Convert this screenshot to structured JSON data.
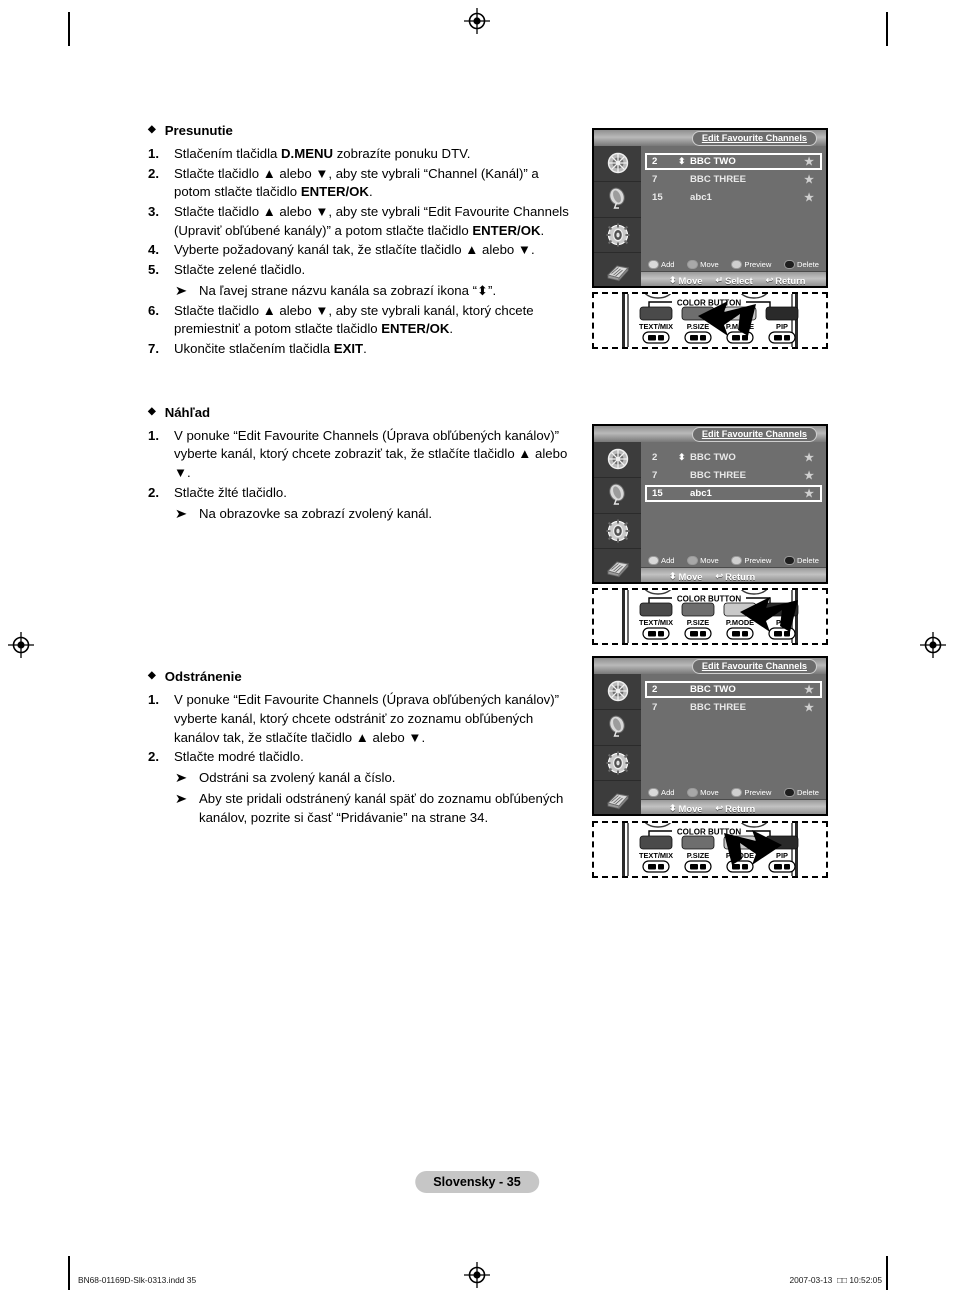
{
  "document": {
    "language_footer": "Slovensky - 35",
    "file_meta": "BN68-01169D-Slk-0313.indd   35",
    "print_meta": "2007-03-13    □□ 10:52:05"
  },
  "sections": [
    {
      "heading": "Presunutie",
      "steps": [
        {
          "num": "1.",
          "html": "Stlačením tlačidla <b>D.MENU</b> zobrazíte ponuku DTV."
        },
        {
          "num": "2.",
          "html": "Stlačte tlačidlo ▲ alebo ▼, aby ste vybrali “Channel (Kanál)” a potom stlačte tlačidlo <b>ENTER/OK</b>."
        },
        {
          "num": "3.",
          "html": "Stlačte tlačidlo ▲ alebo ▼, aby ste vybrali “Edit Favourite Channels (Upraviť obľúbené kanály)” a potom stlačte tlačidlo <b>ENTER/OK</b>."
        },
        {
          "num": "4.",
          "html": "Vyberte požadovaný kanál tak, že stlačíte tlačidlo ▲ alebo ▼."
        },
        {
          "num": "5.",
          "html": "Stlačte zelené tlačidlo.",
          "note": "Na ľavej strane názvu kanála sa zobrazí ikona “⬍”."
        },
        {
          "num": "6.",
          "html": "Stlačte tlačidlo ▲ alebo ▼, aby ste vybrali kanál, ktorý chcete premiestniť a potom stlačte tlačidlo <b>ENTER/OK</b>."
        },
        {
          "num": "7.",
          "html": "Ukončite stlačením tlačidla <b>EXIT</b>."
        }
      ]
    },
    {
      "heading": "Náhľad",
      "steps": [
        {
          "num": "1.",
          "html": "V ponuke “Edit Favourite Channels (Úprava obľúbených kanálov)” vyberte kanál, ktorý chcete zobraziť tak, že stlačíte tlačidlo ▲ alebo ▼."
        },
        {
          "num": "2.",
          "html": "Stlačte žlté tlačidlo.",
          "note": "Na obrazovke sa zobrazí zvolený kanál."
        }
      ]
    },
    {
      "heading": "Odstránenie",
      "steps": [
        {
          "num": "1.",
          "html": "V ponuke “Edit Favourite Channels (Úprava obľúbených kanálov)” vyberte kanál, ktorý chcete odstrániť zo zoznamu obľúbených kanálov tak, že stlačíte tlačidlo ▲ alebo ▼."
        },
        {
          "num": "2.",
          "html": "Stlačte modré tlačidlo.",
          "note": "Odstráni sa zvolený kanál a číslo.",
          "note2": "Aby ste pridali odstránený kanál späť do zoznamu obľúbených kanálov, pozrite si časť “Pridávanie” na strane 34."
        }
      ]
    }
  ],
  "osd_screens": [
    {
      "title": "Edit Favourite Channels",
      "sidebar_icons": [
        "antenna-icon",
        "satellite-dish-icon",
        "setup-gear-icon",
        "manual-book-icon"
      ],
      "channels": [
        {
          "number": "2",
          "move_marker": "⬍",
          "name": "BBC TWO",
          "favourite": "★",
          "selected": true
        },
        {
          "number": "7",
          "move_marker": "",
          "name": "BBC THREE",
          "favourite": "★",
          "selected": false
        },
        {
          "number": "15",
          "move_marker": "",
          "name": "abc1",
          "favourite": "★",
          "selected": false
        }
      ],
      "color_buttons": [
        {
          "label": "Add",
          "color": "#d9d9d9"
        },
        {
          "label": "Move",
          "color": "#a8a8a8"
        },
        {
          "label": "Preview",
          "color": "#cfcfcf"
        },
        {
          "label": "Delete",
          "color": "#1e1e1e"
        }
      ],
      "nav": [
        {
          "glyph": "⬍",
          "label": "Move"
        },
        {
          "glyph": "↵",
          "label": "Select"
        },
        {
          "glyph": "↩",
          "label": "Return"
        }
      ]
    },
    {
      "title": "Edit Favourite Channels",
      "sidebar_icons": [
        "antenna-icon",
        "satellite-dish-icon",
        "setup-gear-icon",
        "manual-book-icon"
      ],
      "channels": [
        {
          "number": "2",
          "move_marker": "⬍",
          "name": "BBC TWO",
          "favourite": "★",
          "selected": false
        },
        {
          "number": "7",
          "move_marker": "",
          "name": "BBC THREE",
          "favourite": "★",
          "selected": false
        },
        {
          "number": "15",
          "move_marker": "",
          "name": "abc1",
          "favourite": "★",
          "selected": true
        }
      ],
      "color_buttons": [
        {
          "label": "Add",
          "color": "#d9d9d9"
        },
        {
          "label": "Move",
          "color": "#a8a8a8"
        },
        {
          "label": "Preview",
          "color": "#cfcfcf"
        },
        {
          "label": "Delete",
          "color": "#1e1e1e"
        }
      ],
      "nav": [
        {
          "glyph": "⬍",
          "label": "Move"
        },
        {
          "glyph": "↩",
          "label": "Return"
        }
      ]
    },
    {
      "title": "Edit Favourite Channels",
      "sidebar_icons": [
        "antenna-icon",
        "satellite-dish-icon",
        "setup-gear-icon",
        "manual-book-icon"
      ],
      "channels": [
        {
          "number": "2",
          "move_marker": "",
          "name": "BBC TWO",
          "favourite": "★",
          "selected": true
        },
        {
          "number": "7",
          "move_marker": "",
          "name": "BBC THREE",
          "favourite": "★",
          "selected": false
        }
      ],
      "color_buttons": [
        {
          "label": "Add",
          "color": "#d9d9d9"
        },
        {
          "label": "Move",
          "color": "#a8a8a8"
        },
        {
          "label": "Preview",
          "color": "#cfcfcf"
        },
        {
          "label": "Delete",
          "color": "#1e1e1e"
        }
      ],
      "nav": [
        {
          "glyph": "⬍",
          "label": "Move"
        },
        {
          "glyph": "↩",
          "label": "Return"
        }
      ]
    }
  ],
  "remotes": [
    {
      "group_label": "COLOR BUTTON",
      "buttons": [
        {
          "label": "TEXT/MIX",
          "icon": "text-mix-icon"
        },
        {
          "label": "P.SIZE",
          "icon": "picture-size-icon"
        },
        {
          "label": "P.MODE",
          "icon": "picture-mode-icon"
        },
        {
          "label": "PIP",
          "icon": "pip-icon"
        }
      ],
      "highlight_index": 1,
      "arrow_direction": "left"
    },
    {
      "group_label": "COLOR BUTTON",
      "buttons": [
        {
          "label": "TEXT/MIX",
          "icon": "text-mix-icon"
        },
        {
          "label": "P.SIZE",
          "icon": "picture-size-icon"
        },
        {
          "label": "P.MODE",
          "icon": "picture-mode-icon"
        },
        {
          "label": "PIP",
          "icon": "pip-icon"
        }
      ],
      "highlight_index": 2,
      "arrow_direction": "left"
    },
    {
      "group_label": "COLOR BUTTON",
      "buttons": [
        {
          "label": "TEXT/MIX",
          "icon": "text-mix-icon"
        },
        {
          "label": "P.SIZE",
          "icon": "picture-size-icon"
        },
        {
          "label": "P.MODE",
          "icon": "picture-mode-icon"
        },
        {
          "label": "PIP",
          "icon": "pip-icon"
        }
      ],
      "highlight_index": 3,
      "arrow_direction": "right"
    }
  ]
}
